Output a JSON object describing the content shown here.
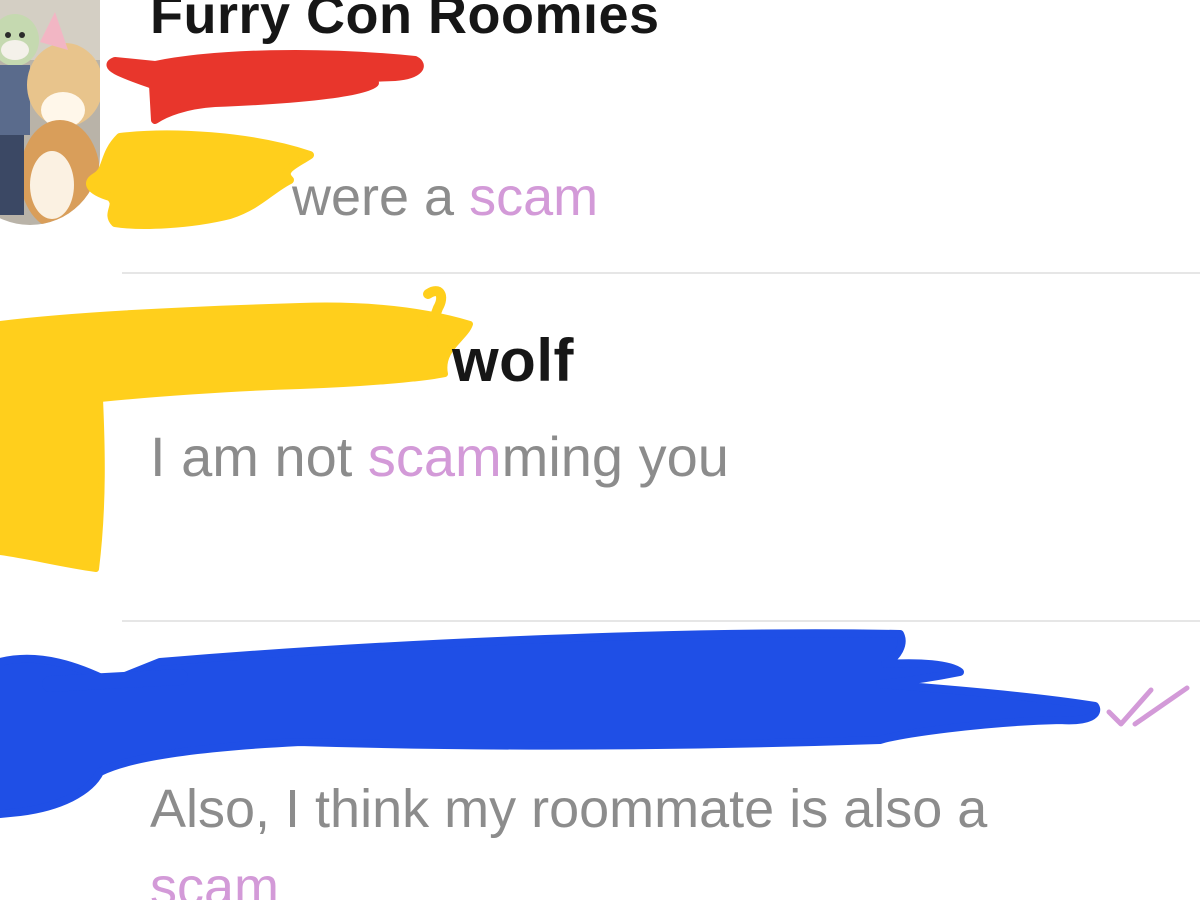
{
  "chats": [
    {
      "title": "Furry Con Roomies",
      "preview_prefix": "were a ",
      "preview_highlight": "scam",
      "preview_suffix": ""
    },
    {
      "title": "wolf",
      "preview_prefix": "I am not ",
      "preview_highlight": "scam",
      "preview_suffix": "ming you"
    },
    {
      "title": "",
      "preview_prefix": "Also, I think my roommate is also a",
      "preview_highlight": "scam",
      "preview_suffix": "",
      "read_icon": "double-check-icon"
    }
  ],
  "colors": {
    "highlight": "#d39ad8",
    "preview_text": "#8c8c8c",
    "title_text": "#161616",
    "divider": "#e6e6e6",
    "redact_red": "#e8362c",
    "redact_yellow": "#ffcf1c",
    "redact_blue": "#1f4fe6"
  }
}
